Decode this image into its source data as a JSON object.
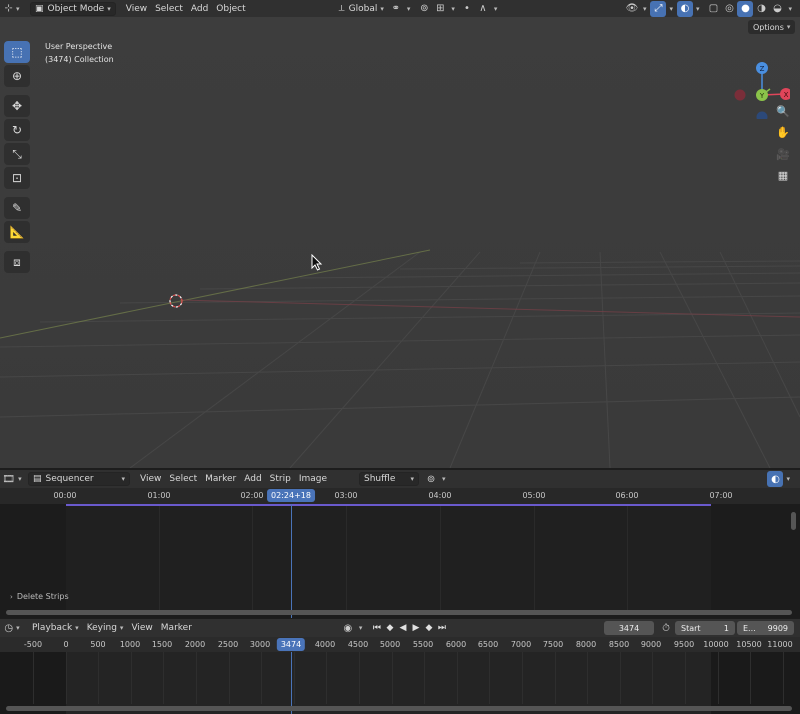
{
  "top_header": {
    "mode": "Object Mode",
    "menus": [
      "View",
      "Select",
      "Add",
      "Object"
    ],
    "orientation": "Global"
  },
  "viewport": {
    "perspective": "User Perspective",
    "collection": "(3474) Collection",
    "options_label": "Options",
    "gizmo_axes": [
      "Z",
      "X",
      "Y"
    ]
  },
  "tools": [
    "select-box",
    "cursor",
    "move",
    "rotate",
    "scale",
    "transform",
    "annotate",
    "measure",
    "add-cube"
  ],
  "sequencer_header": {
    "editor": "Sequencer",
    "menus": [
      "View",
      "Select",
      "Marker",
      "Add",
      "Strip",
      "Image"
    ],
    "overlap_mode": "Shuffle"
  },
  "sequencer": {
    "ruler_labels": [
      "00:00",
      "01:00",
      "02:00",
      "03:00",
      "04:00",
      "05:00",
      "06:00",
      "07:00"
    ],
    "playhead": "02:24+18",
    "last_operation": "Delete Strips"
  },
  "timeline_header": {
    "menus": [
      "Playback",
      "Keying",
      "View",
      "Marker"
    ],
    "current_frame": "3474",
    "start_label": "Start",
    "start_value": "1",
    "end_label": "E...",
    "end_value": "9909"
  },
  "timeline": {
    "ruler_labels": [
      "-500",
      "0",
      "500",
      "1000",
      "1500",
      "2000",
      "2500",
      "3000",
      "3474",
      "4000",
      "4500",
      "5000",
      "5500",
      "6000",
      "6500",
      "7000",
      "7500",
      "8000",
      "8500",
      "9000",
      "9500",
      "10000",
      "10500",
      "11000"
    ]
  },
  "colors": {
    "accent": "#4772b3",
    "strip_bar": "#6a5acd",
    "axis_x": "#e0455a",
    "axis_y": "#8bc34a",
    "axis_z": "#4a8fe0"
  }
}
